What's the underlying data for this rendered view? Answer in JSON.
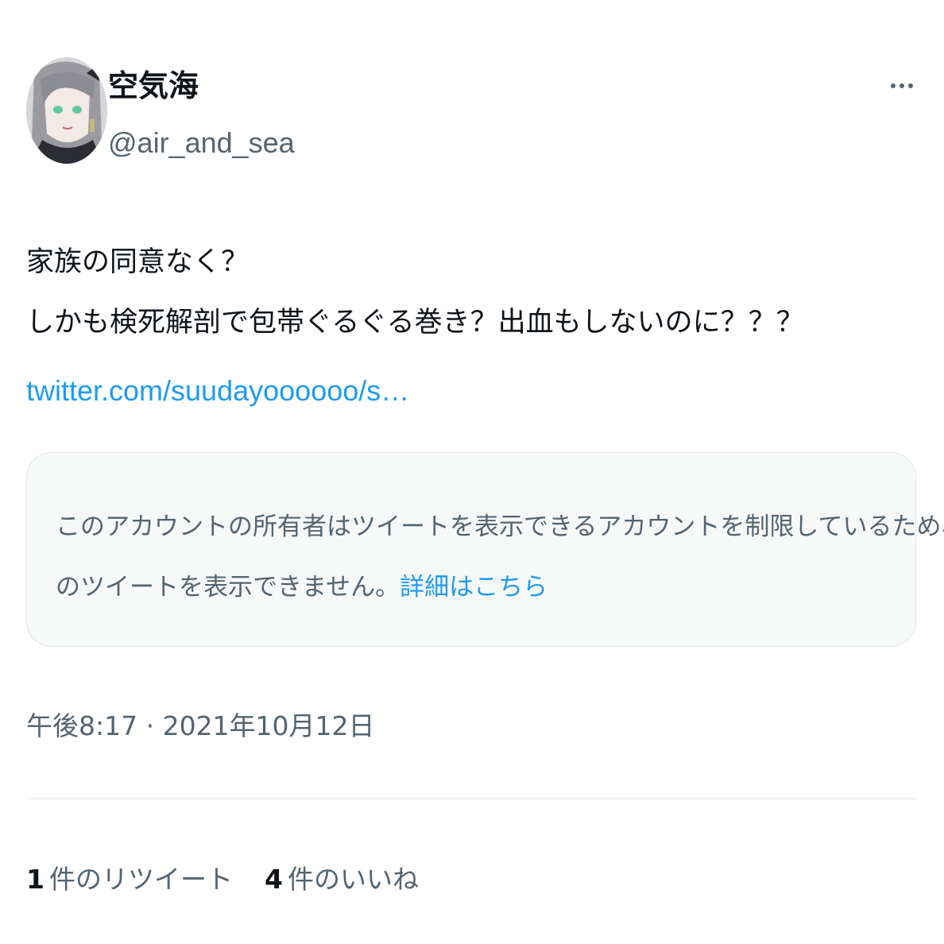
{
  "user": {
    "display_name": "空気海",
    "handle": "@air_and_sea",
    "avatar_icon": "avatar-illustration"
  },
  "tweet": {
    "lines": [
      "家族の同意なく？",
      "しかも検死解剖で包帯ぐるぐる巻き？出血もしないのに？？？"
    ],
    "link": "twitter.com/suudayoooooo/s…"
  },
  "quoted": {
    "line1": "このアカウントの所有者はツイートを表示できるアカウントを制限しているため、こ",
    "line2": "のツイートを表示できません。",
    "learn_more": "詳細はこちら"
  },
  "timestamp": "午後8:17 · 2021年10月12日",
  "stats": {
    "retweets_count": "1",
    "retweets_label": "件のリツイート",
    "likes_count": "4",
    "likes_label": "件のいいね"
  },
  "colors": {
    "link": "#1d9bf0",
    "secondary_text": "#536471",
    "quote_background": "#f7f9f9"
  }
}
